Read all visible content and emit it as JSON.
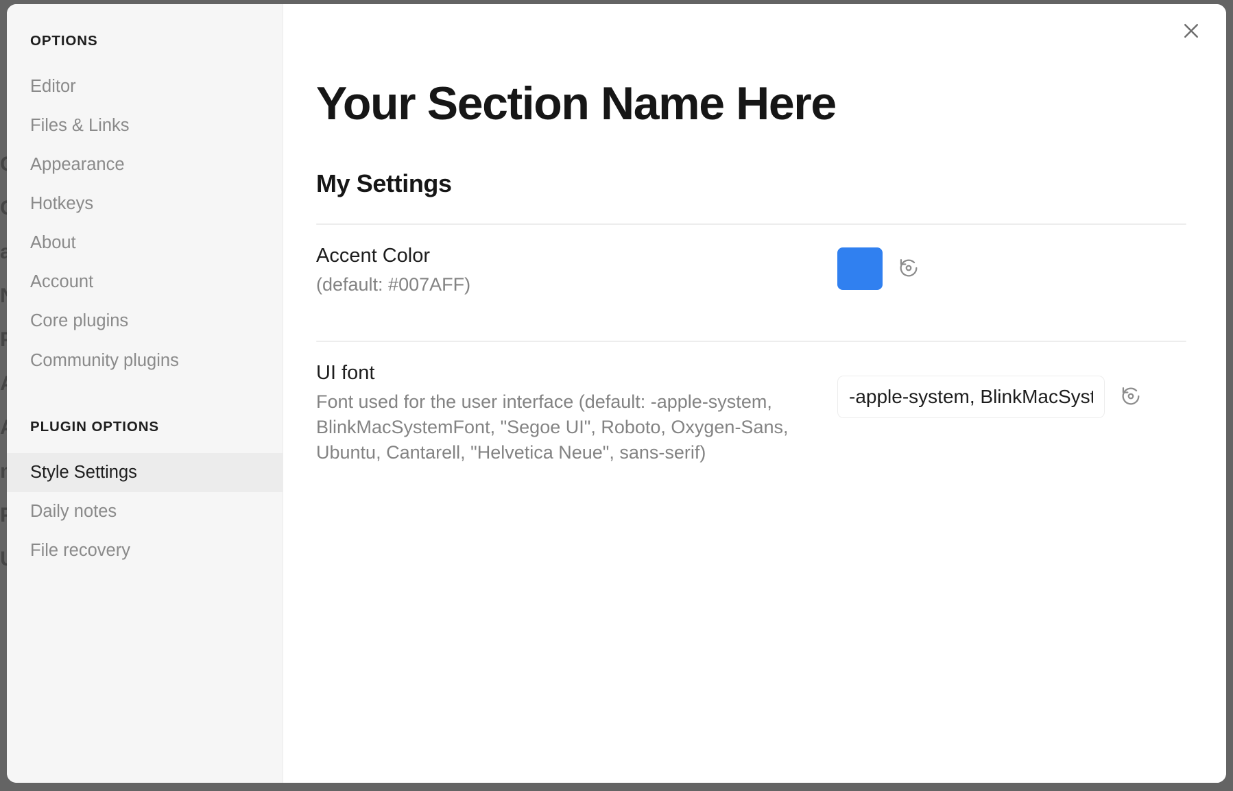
{
  "window": {
    "close_icon": "close-icon"
  },
  "backdrop": {
    "bleed_lines": [
      "C",
      "C",
      "as",
      "No",
      "Pr",
      "AC",
      "AI",
      "m",
      "Po",
      "Ur"
    ]
  },
  "sidebar": {
    "groups": [
      {
        "header": "OPTIONS",
        "items": [
          {
            "label": "Editor",
            "active": false
          },
          {
            "label": "Files & Links",
            "active": false
          },
          {
            "label": "Appearance",
            "active": false
          },
          {
            "label": "Hotkeys",
            "active": false
          },
          {
            "label": "About",
            "active": false
          },
          {
            "label": "Account",
            "active": false
          },
          {
            "label": "Core plugins",
            "active": false
          },
          {
            "label": "Community plugins",
            "active": false
          }
        ]
      },
      {
        "header": "PLUGIN OPTIONS",
        "items": [
          {
            "label": "Style Settings",
            "active": true
          },
          {
            "label": "Daily notes",
            "active": false
          },
          {
            "label": "File recovery",
            "active": false
          }
        ]
      }
    ]
  },
  "main": {
    "page_title": "Your Section Name Here",
    "section_title": "My Settings",
    "settings": [
      {
        "name": "Accent Color",
        "description": "(default: #007AFF)",
        "control": "color",
        "value": "#3080f0",
        "reset_icon": "reset-icon"
      },
      {
        "name": "UI font",
        "description": "Font used for the user interface (default: -apple-system, BlinkMacSystemFont, \"Segoe UI\", Roboto, Oxygen-Sans, Ubuntu, Cantarell, \"Helvetica Neue\", sans-serif)",
        "control": "text",
        "value": "-apple-system, BlinkMacSystemFont, \"Segoe UI\", Roboto, Oxygen-Sans, Ubuntu, Cantarell, \"Helvetica Neue\", sans-serif",
        "placeholder": "",
        "reset_icon": "reset-icon"
      }
    ]
  },
  "colors": {
    "accent": "#3080f0",
    "accent_default": "#007AFF",
    "sidebar_bg": "#f6f6f6",
    "active_item_bg": "#ececec",
    "divider": "#ededed",
    "backdrop": "#646464"
  }
}
